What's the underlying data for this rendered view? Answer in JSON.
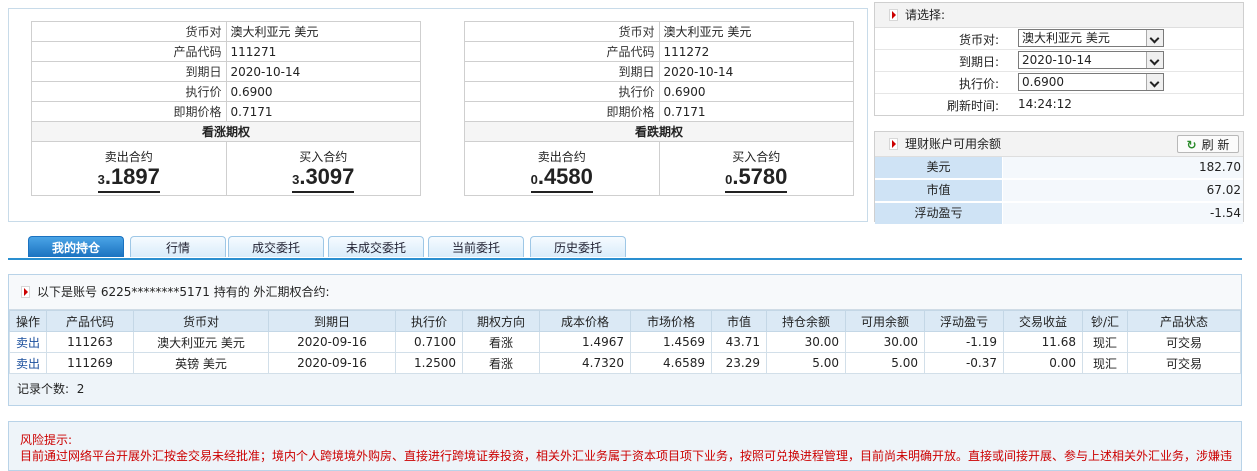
{
  "quotes": [
    {
      "rows": [
        {
          "label": "货币对",
          "value": "澳大利亚元 美元"
        },
        {
          "label": "产品代码",
          "value": "111271"
        },
        {
          "label": "到期日",
          "value": "2020-10-14"
        },
        {
          "label": "执行价",
          "value": "0.6900"
        },
        {
          "label": "即期价格",
          "value": "0.7171"
        }
      ],
      "title": "看涨期权",
      "sell_label": "卖出合约",
      "sell_prefix": "3",
      "sell_value": ".1897",
      "buy_label": "买入合约",
      "buy_prefix": "3",
      "buy_value": ".3097"
    },
    {
      "rows": [
        {
          "label": "货币对",
          "value": "澳大利亚元 美元"
        },
        {
          "label": "产品代码",
          "value": "111272"
        },
        {
          "label": "到期日",
          "value": "2020-10-14"
        },
        {
          "label": "执行价",
          "value": "0.6900"
        },
        {
          "label": "即期价格",
          "value": "0.7171"
        }
      ],
      "title": "看跌期权",
      "sell_label": "卖出合约",
      "sell_prefix": "0",
      "sell_value": ".4580",
      "buy_label": "买入合约",
      "buy_prefix": "0",
      "buy_value": ".5780"
    }
  ],
  "select_panel": {
    "title": "请选择:",
    "currency_label": "货币对:",
    "currency_value": "澳大利亚元 美元",
    "expiry_label": "到期日:",
    "expiry_value": "2020-10-14",
    "strike_label": "执行价:",
    "strike_value": "0.6900",
    "refresh_time_label": "刷新时间:",
    "refresh_time_value": "14:24:12"
  },
  "balance_panel": {
    "title": "理财账户可用余额",
    "refresh_label": "刷 新",
    "rows": [
      {
        "label": "美元",
        "value": "182.70"
      },
      {
        "label": "市值",
        "value": "67.02"
      },
      {
        "label": "浮动盈亏",
        "value": "-1.54"
      }
    ]
  },
  "tabs": [
    "我的持仓",
    "行情",
    "成交委托",
    "未成交委托",
    "当前委托",
    "历史委托"
  ],
  "active_tab": 0,
  "holdings": {
    "header": "以下是账号 6225********5171 持有的 外汇期权合约:",
    "columns": [
      "操作",
      "产品代码",
      "货币对",
      "到期日",
      "执行价",
      "期权方向",
      "成本价格",
      "市场价格",
      "市值",
      "持仓余额",
      "可用余额",
      "浮动盈亏",
      "交易收益",
      "钞/汇",
      "产品状态"
    ],
    "rows": [
      [
        "卖出",
        "111263",
        "澳大利亚元 美元",
        "2020-09-16",
        "0.7100",
        "看涨",
        "1.4967",
        "1.4569",
        "43.71",
        "30.00",
        "30.00",
        "-1.19",
        "11.68",
        "现汇",
        "可交易"
      ],
      [
        "卖出",
        "111269",
        "英镑 美元",
        "2020-09-16",
        "1.2500",
        "看涨",
        "4.7320",
        "4.6589",
        "23.29",
        "5.00",
        "5.00",
        "-0.37",
        "0.00",
        "现汇",
        "可交易"
      ]
    ],
    "record_count_label": "记录个数:",
    "record_count": "2"
  },
  "risk": {
    "title": "风险提示:",
    "text": "目前通过网络平台开展外汇按金交易未经批准；境内个人跨境境外购房、直接进行跨境证券投资，相关外汇业务属于资本项目项下业务，按照可兑换进程管理，目前尚未明确开放。直接或间接开展、参与上述相关外汇业务，涉嫌违"
  }
}
